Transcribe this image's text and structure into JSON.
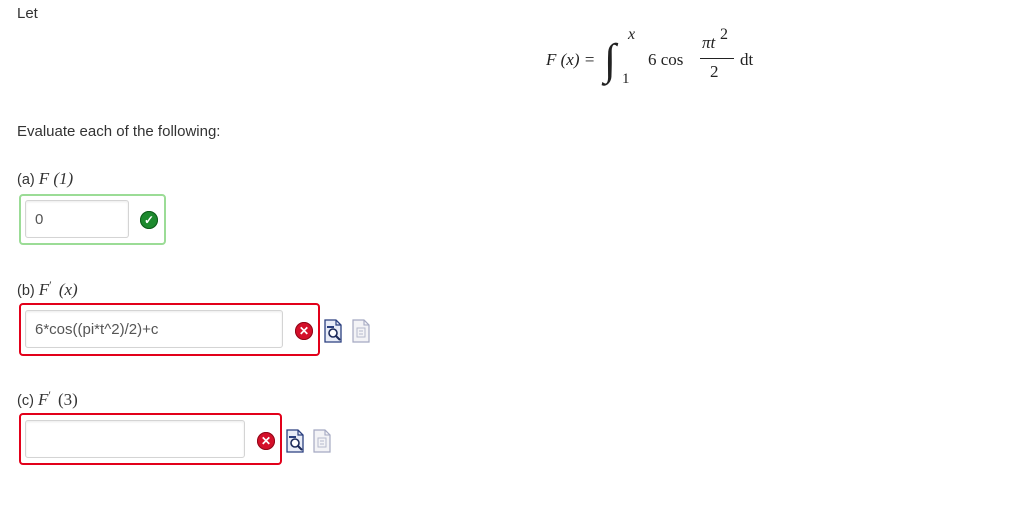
{
  "intro": "Let",
  "formula": {
    "lhs": "F (x) =",
    "upper_limit": "x",
    "lower_limit": "1",
    "coefficient": "6 cos",
    "numerator": "πt",
    "exponent": "2",
    "denominator": "2",
    "differential": "dt"
  },
  "prompt": "Evaluate each of the following:",
  "questions": [
    {
      "part": "(a)",
      "expr": "F (1)",
      "value": "0",
      "status": "correct"
    },
    {
      "part": "(b)",
      "expr": "F",
      "prime": "′",
      "arg": "(x)",
      "value": "6*cos((pi*t^2)/2)+c",
      "status": "incorrect"
    },
    {
      "part": "(c)",
      "expr": "F",
      "prime": "′",
      "arg": "(3)",
      "value": "",
      "status": "incorrect"
    }
  ],
  "colors": {
    "correct": "#1d8a2e",
    "incorrect": "#d40f2a",
    "correct_border": "#9bdc96",
    "incorrect_border": "#e2001a"
  },
  "icons": {
    "correct": "check-circle-icon",
    "incorrect": "x-circle-icon",
    "preview": "equation-preview-icon",
    "helper": "equation-helper-icon"
  }
}
